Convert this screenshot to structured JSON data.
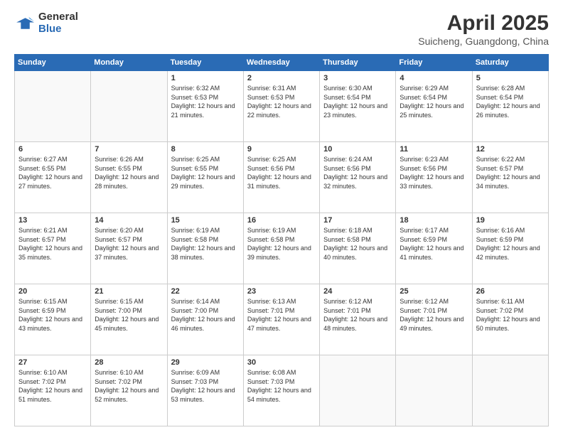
{
  "logo": {
    "general": "General",
    "blue": "Blue"
  },
  "title": "April 2025",
  "subtitle": "Suicheng, Guangdong, China",
  "header_days": [
    "Sunday",
    "Monday",
    "Tuesday",
    "Wednesday",
    "Thursday",
    "Friday",
    "Saturday"
  ],
  "weeks": [
    [
      {
        "day": null
      },
      {
        "day": null
      },
      {
        "day": "1",
        "sunrise": "Sunrise: 6:32 AM",
        "sunset": "Sunset: 6:53 PM",
        "daylight": "Daylight: 12 hours and 21 minutes."
      },
      {
        "day": "2",
        "sunrise": "Sunrise: 6:31 AM",
        "sunset": "Sunset: 6:53 PM",
        "daylight": "Daylight: 12 hours and 22 minutes."
      },
      {
        "day": "3",
        "sunrise": "Sunrise: 6:30 AM",
        "sunset": "Sunset: 6:54 PM",
        "daylight": "Daylight: 12 hours and 23 minutes."
      },
      {
        "day": "4",
        "sunrise": "Sunrise: 6:29 AM",
        "sunset": "Sunset: 6:54 PM",
        "daylight": "Daylight: 12 hours and 25 minutes."
      },
      {
        "day": "5",
        "sunrise": "Sunrise: 6:28 AM",
        "sunset": "Sunset: 6:54 PM",
        "daylight": "Daylight: 12 hours and 26 minutes."
      }
    ],
    [
      {
        "day": "6",
        "sunrise": "Sunrise: 6:27 AM",
        "sunset": "Sunset: 6:55 PM",
        "daylight": "Daylight: 12 hours and 27 minutes."
      },
      {
        "day": "7",
        "sunrise": "Sunrise: 6:26 AM",
        "sunset": "Sunset: 6:55 PM",
        "daylight": "Daylight: 12 hours and 28 minutes."
      },
      {
        "day": "8",
        "sunrise": "Sunrise: 6:25 AM",
        "sunset": "Sunset: 6:55 PM",
        "daylight": "Daylight: 12 hours and 29 minutes."
      },
      {
        "day": "9",
        "sunrise": "Sunrise: 6:25 AM",
        "sunset": "Sunset: 6:56 PM",
        "daylight": "Daylight: 12 hours and 31 minutes."
      },
      {
        "day": "10",
        "sunrise": "Sunrise: 6:24 AM",
        "sunset": "Sunset: 6:56 PM",
        "daylight": "Daylight: 12 hours and 32 minutes."
      },
      {
        "day": "11",
        "sunrise": "Sunrise: 6:23 AM",
        "sunset": "Sunset: 6:56 PM",
        "daylight": "Daylight: 12 hours and 33 minutes."
      },
      {
        "day": "12",
        "sunrise": "Sunrise: 6:22 AM",
        "sunset": "Sunset: 6:57 PM",
        "daylight": "Daylight: 12 hours and 34 minutes."
      }
    ],
    [
      {
        "day": "13",
        "sunrise": "Sunrise: 6:21 AM",
        "sunset": "Sunset: 6:57 PM",
        "daylight": "Daylight: 12 hours and 35 minutes."
      },
      {
        "day": "14",
        "sunrise": "Sunrise: 6:20 AM",
        "sunset": "Sunset: 6:57 PM",
        "daylight": "Daylight: 12 hours and 37 minutes."
      },
      {
        "day": "15",
        "sunrise": "Sunrise: 6:19 AM",
        "sunset": "Sunset: 6:58 PM",
        "daylight": "Daylight: 12 hours and 38 minutes."
      },
      {
        "day": "16",
        "sunrise": "Sunrise: 6:19 AM",
        "sunset": "Sunset: 6:58 PM",
        "daylight": "Daylight: 12 hours and 39 minutes."
      },
      {
        "day": "17",
        "sunrise": "Sunrise: 6:18 AM",
        "sunset": "Sunset: 6:58 PM",
        "daylight": "Daylight: 12 hours and 40 minutes."
      },
      {
        "day": "18",
        "sunrise": "Sunrise: 6:17 AM",
        "sunset": "Sunset: 6:59 PM",
        "daylight": "Daylight: 12 hours and 41 minutes."
      },
      {
        "day": "19",
        "sunrise": "Sunrise: 6:16 AM",
        "sunset": "Sunset: 6:59 PM",
        "daylight": "Daylight: 12 hours and 42 minutes."
      }
    ],
    [
      {
        "day": "20",
        "sunrise": "Sunrise: 6:15 AM",
        "sunset": "Sunset: 6:59 PM",
        "daylight": "Daylight: 12 hours and 43 minutes."
      },
      {
        "day": "21",
        "sunrise": "Sunrise: 6:15 AM",
        "sunset": "Sunset: 7:00 PM",
        "daylight": "Daylight: 12 hours and 45 minutes."
      },
      {
        "day": "22",
        "sunrise": "Sunrise: 6:14 AM",
        "sunset": "Sunset: 7:00 PM",
        "daylight": "Daylight: 12 hours and 46 minutes."
      },
      {
        "day": "23",
        "sunrise": "Sunrise: 6:13 AM",
        "sunset": "Sunset: 7:01 PM",
        "daylight": "Daylight: 12 hours and 47 minutes."
      },
      {
        "day": "24",
        "sunrise": "Sunrise: 6:12 AM",
        "sunset": "Sunset: 7:01 PM",
        "daylight": "Daylight: 12 hours and 48 minutes."
      },
      {
        "day": "25",
        "sunrise": "Sunrise: 6:12 AM",
        "sunset": "Sunset: 7:01 PM",
        "daylight": "Daylight: 12 hours and 49 minutes."
      },
      {
        "day": "26",
        "sunrise": "Sunrise: 6:11 AM",
        "sunset": "Sunset: 7:02 PM",
        "daylight": "Daylight: 12 hours and 50 minutes."
      }
    ],
    [
      {
        "day": "27",
        "sunrise": "Sunrise: 6:10 AM",
        "sunset": "Sunset: 7:02 PM",
        "daylight": "Daylight: 12 hours and 51 minutes."
      },
      {
        "day": "28",
        "sunrise": "Sunrise: 6:10 AM",
        "sunset": "Sunset: 7:02 PM",
        "daylight": "Daylight: 12 hours and 52 minutes."
      },
      {
        "day": "29",
        "sunrise": "Sunrise: 6:09 AM",
        "sunset": "Sunset: 7:03 PM",
        "daylight": "Daylight: 12 hours and 53 minutes."
      },
      {
        "day": "30",
        "sunrise": "Sunrise: 6:08 AM",
        "sunset": "Sunset: 7:03 PM",
        "daylight": "Daylight: 12 hours and 54 minutes."
      },
      {
        "day": null
      },
      {
        "day": null
      },
      {
        "day": null
      }
    ]
  ]
}
